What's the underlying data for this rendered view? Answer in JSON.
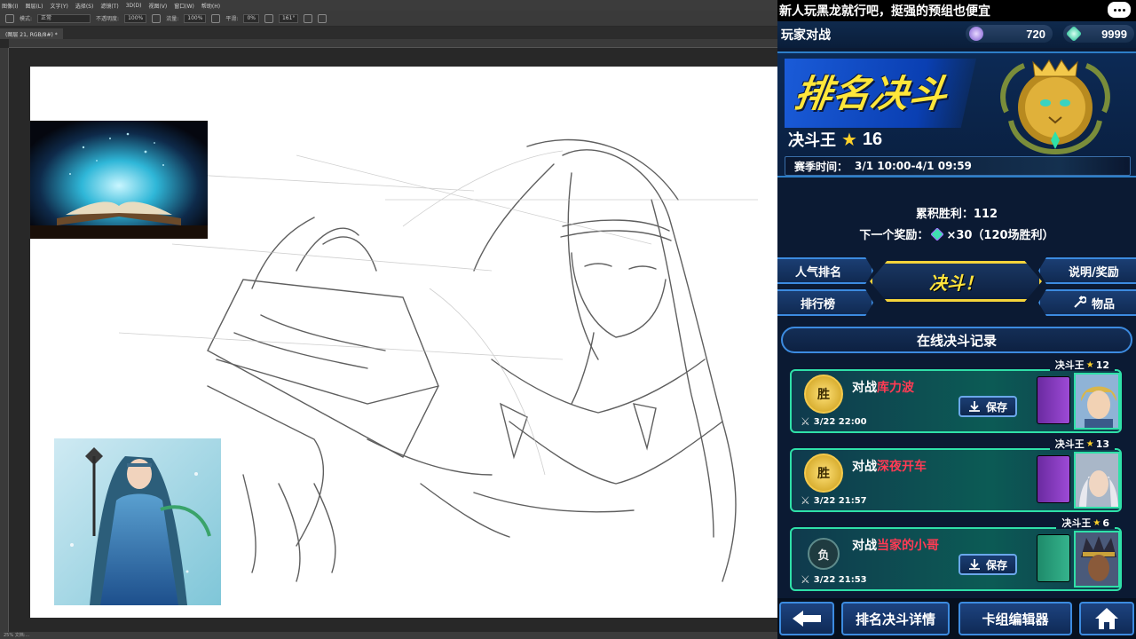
{
  "photoshop": {
    "menu": [
      "图像(I)",
      "图层(L)",
      "文字(Y)",
      "选择(S)",
      "滤镜(T)",
      "3D(D)",
      "视图(V)",
      "窗口(W)",
      "帮助(H)"
    ],
    "options": {
      "mode_label": "模式:",
      "mode_value": "正常",
      "opacity_label": "不透明度:",
      "opacity_value": "100%",
      "flow_label": "流量:",
      "flow_value": "100%",
      "smooth_label": "平滑:",
      "smooth_value": "0%",
      "angle_value": "161°"
    },
    "doc_tab": "(图层 21, RGB/8#) *",
    "status": "25% 文档:..."
  },
  "game": {
    "chat_text": "新人玩黑龙就行吧，挺强的预组也便宜",
    "screen_title": "玩家对战",
    "currency1": "720",
    "currency2": "9999",
    "banner_title": "排名决斗",
    "rank_name": "决斗王",
    "rank_star": "★",
    "rank_level": "16",
    "season_label": "赛季时间：",
    "season_value": "3/1 10:00-4/1 09:59",
    "wins_text": "累积胜利：112",
    "reward_label": "下一个奖励：",
    "reward_value": "×30（120场胜利）",
    "btn_popular": "人气排名",
    "btn_leaderboard": "排行榜",
    "btn_duel": "决斗！",
    "btn_info": "说明/奖励",
    "btn_items": "物品",
    "online_header": "在线决斗记录",
    "records": [
      {
        "badge_rank": "决斗王",
        "badge_level": "12",
        "result": "胜",
        "prefix": "对战",
        "opponent": "库力波",
        "time": "3/22 22:00",
        "save": "保存"
      },
      {
        "badge_rank": "决斗王",
        "badge_level": "13",
        "result": "胜",
        "prefix": "对战",
        "opponent": "深夜开车",
        "time": "3/22 21:57",
        "save": "保存"
      },
      {
        "badge_rank": "决斗王",
        "badge_level": "6",
        "result": "负",
        "prefix": "对战",
        "opponent": "当家的小哥",
        "time": "3/22 21:53",
        "save": "保存"
      }
    ],
    "bottom_btn1": "排名决斗详情",
    "bottom_btn2": "卡组编辑器",
    "colors": {
      "accent_blue": "#3c8be0",
      "title_yellow": "#ffe63a",
      "opponent_red": "#ff3b54",
      "record_border": "#2fe0a8"
    }
  }
}
